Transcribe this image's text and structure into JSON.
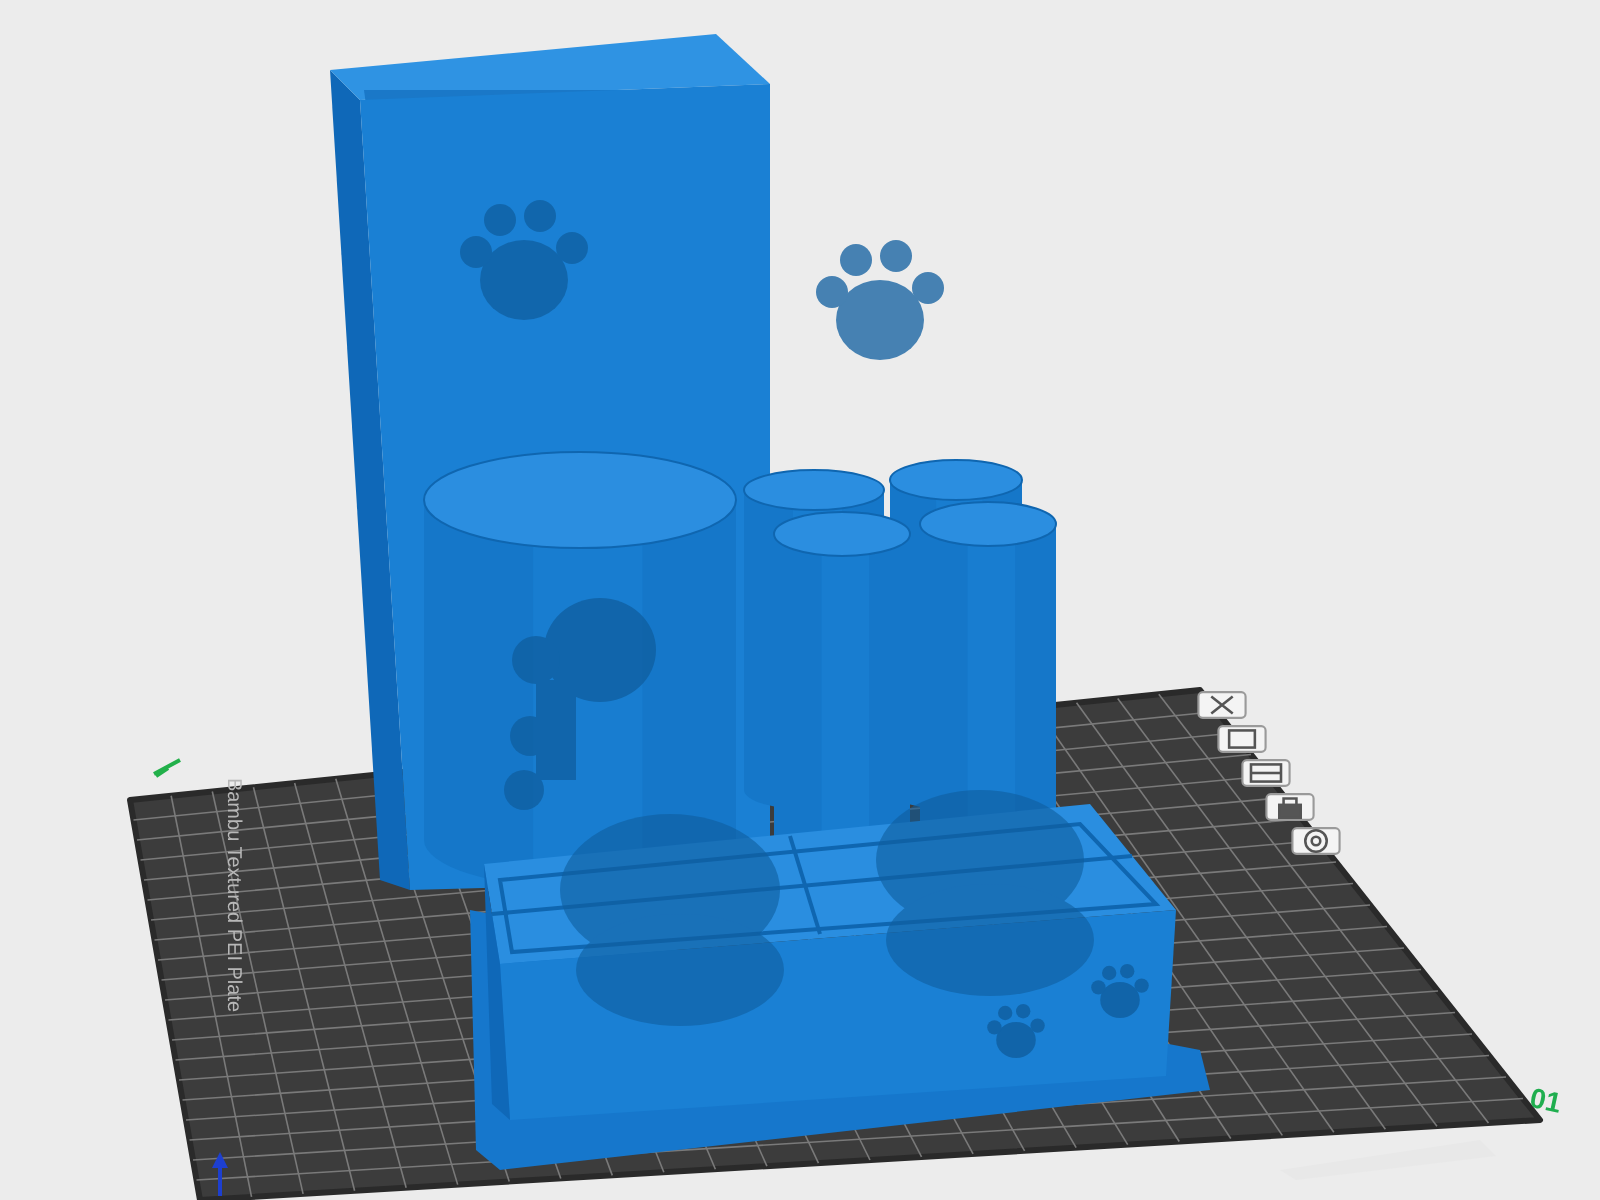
{
  "viewport": {
    "plate_name": "Bambu Textured PEI Plate",
    "plate_number": "01"
  }
}
